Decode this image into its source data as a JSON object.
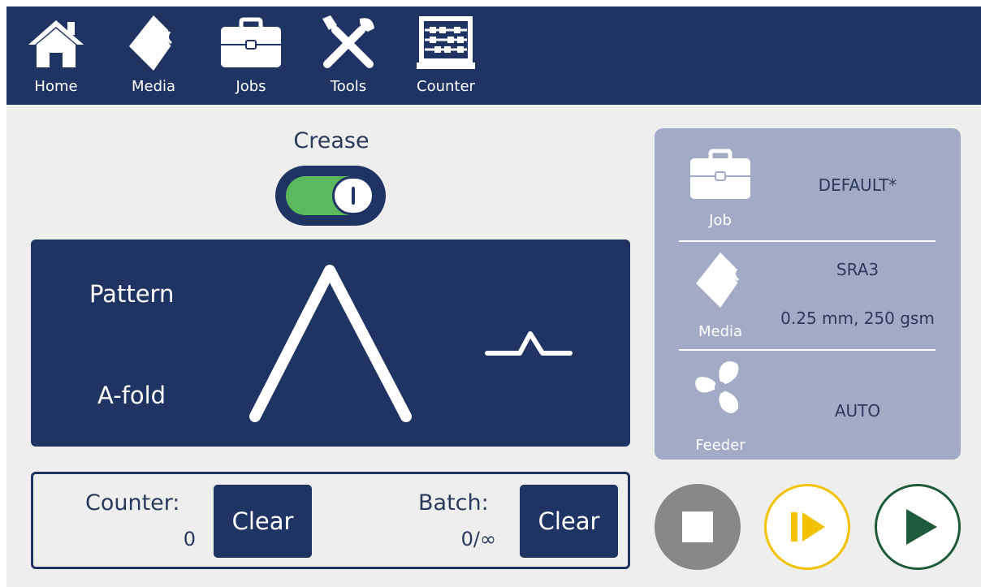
{
  "nav": {
    "items": [
      {
        "label": "Home",
        "icon": "home-icon"
      },
      {
        "label": "Media",
        "icon": "media-sheet-icon"
      },
      {
        "label": "Jobs",
        "icon": "briefcase-icon"
      },
      {
        "label": "Tools",
        "icon": "tools-icon"
      },
      {
        "label": "Counter",
        "icon": "abacus-icon"
      }
    ]
  },
  "crease": {
    "label": "Crease",
    "toggle_state": "on"
  },
  "pattern": {
    "label": "Pattern",
    "value": "A-fold"
  },
  "counter": {
    "counter_label": "Counter:",
    "counter_value": "0",
    "counter_clear": "Clear",
    "batch_label": "Batch:",
    "batch_value": "0/∞",
    "batch_clear": "Clear"
  },
  "status": {
    "job": {
      "label": "Job",
      "value": "DEFAULT*"
    },
    "media": {
      "label": "Media",
      "value_line1": "SRA3",
      "value_line2": "0.25 mm, 250 gsm"
    },
    "feeder": {
      "label": "Feeder",
      "value": "AUTO"
    }
  },
  "controls": {
    "stop_icon": "stop-icon",
    "step_icon": "single-step-icon",
    "play_icon": "play-icon"
  },
  "colors": {
    "navy": "#203463",
    "toggle_on": "#5cb85c",
    "status_panel": "#a2abc6",
    "stop": "#888888",
    "step_ring": "#f2c200",
    "play_ring": "#1e5b3a"
  }
}
